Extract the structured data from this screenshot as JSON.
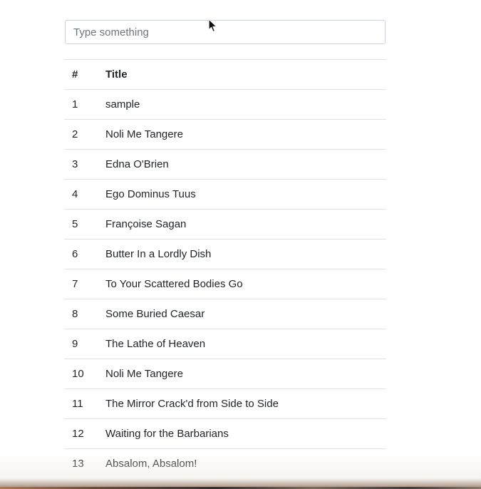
{
  "search": {
    "placeholder": "Type something",
    "value": ""
  },
  "table": {
    "headers": {
      "number": "#",
      "title": "Title"
    },
    "rows": [
      {
        "number": "1",
        "title": "sample"
      },
      {
        "number": "2",
        "title": "Noli Me Tangere"
      },
      {
        "number": "3",
        "title": "Edna O'Brien"
      },
      {
        "number": "4",
        "title": "Ego Dominus Tuus"
      },
      {
        "number": "5",
        "title": "Françoise Sagan"
      },
      {
        "number": "6",
        "title": "Butter In a Lordly Dish"
      },
      {
        "number": "7",
        "title": "To Your Scattered Bodies Go"
      },
      {
        "number": "8",
        "title": "Some Buried Caesar"
      },
      {
        "number": "9",
        "title": "The Lathe of Heaven"
      },
      {
        "number": "10",
        "title": "Noli Me Tangere"
      },
      {
        "number": "11",
        "title": "The Mirror Crack'd from Side to Side"
      },
      {
        "number": "12",
        "title": "Waiting for the Barbarians"
      },
      {
        "number": "13",
        "title": "Absalom, Absalom!"
      }
    ]
  },
  "cursor": {
    "icon": "mouse-pointer-icon"
  }
}
